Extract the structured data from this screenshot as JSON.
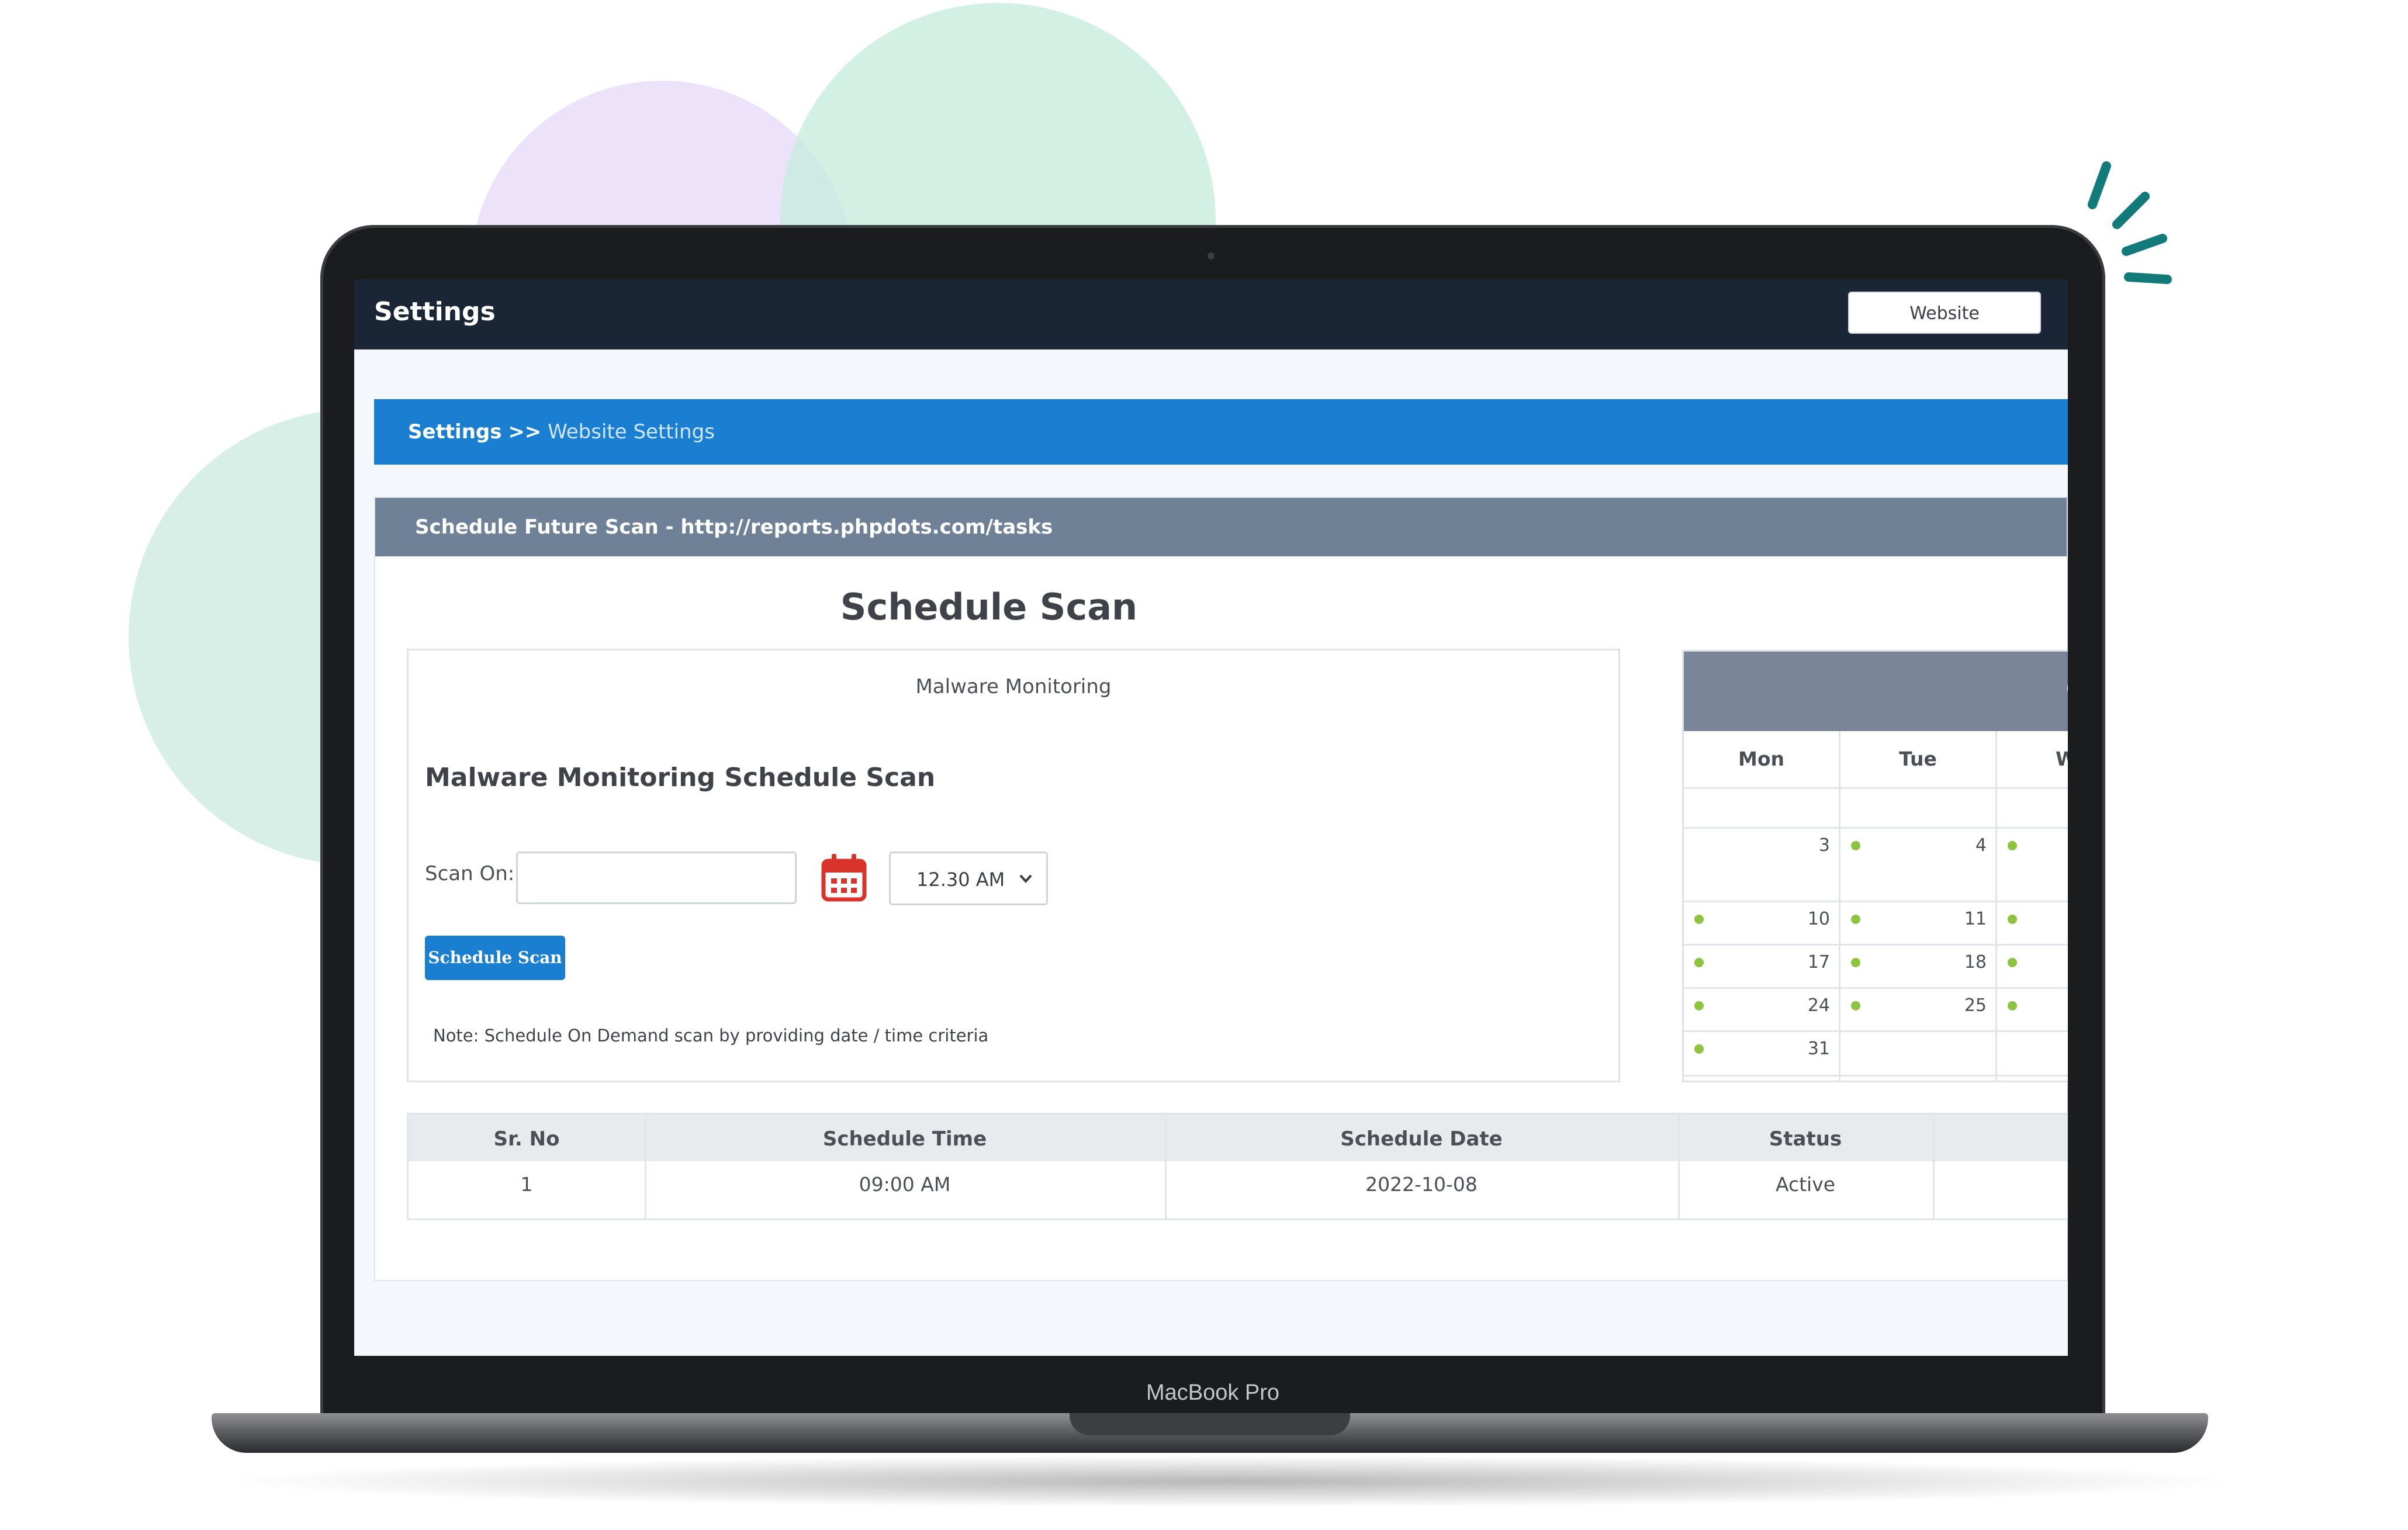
{
  "window": {
    "app_title": "Settings",
    "website_button": "Website"
  },
  "breadcrumb": {
    "home": "Settings",
    "separator": ">>",
    "current": "Website Settings"
  },
  "panel": {
    "header": "Schedule Future Scan - http://reports.phpdots.com/tasks"
  },
  "page": {
    "heading": "Schedule Scan"
  },
  "form": {
    "subtitle": "Malware Monitoring",
    "title": "Malware Monitoring Schedule Scan",
    "scan_on_label": "Scan On:",
    "date_value": "",
    "time_value": "12.30 AM",
    "button": "Schedule Scan",
    "note": "Note: Schedule On Demand scan by providing date / time criteria"
  },
  "calendar": {
    "header_fragment": "O",
    "days": [
      "Mon",
      "Tue",
      "We"
    ],
    "dates": {
      "mon": [
        "3",
        "10",
        "17",
        "24",
        "31"
      ],
      "tue": [
        "4",
        "11",
        "18",
        "25"
      ]
    },
    "dot_color": "#8cc43f"
  },
  "table": {
    "headers": [
      "Sr. No",
      "Schedule Time",
      "Schedule Date",
      "Status"
    ],
    "rows": [
      [
        "1",
        "09:00 AM",
        "2022-10-08",
        "Active"
      ]
    ]
  },
  "device": {
    "label": "MacBook Pro"
  },
  "colors": {
    "topbar": "#1a2636",
    "accent": "#1b7fd1",
    "panel_header": "#6f8197"
  }
}
